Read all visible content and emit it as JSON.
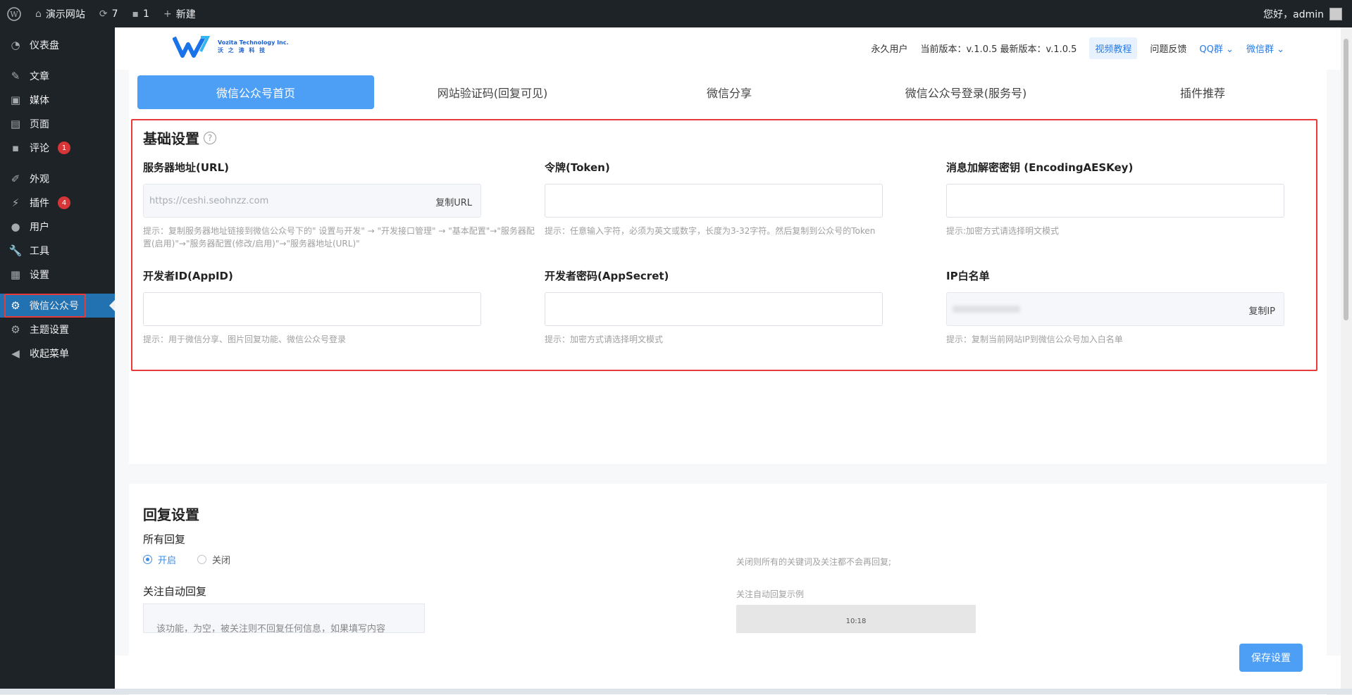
{
  "adminbar": {
    "site_name": "演示网站",
    "updates_count": "7",
    "comments_count": "1",
    "new_label": "新建",
    "greeting": "您好，admin"
  },
  "sidebar": {
    "items": [
      {
        "label": "仪表盘",
        "icon": "dashboard-icon"
      },
      {
        "label": "文章",
        "icon": "pin-icon"
      },
      {
        "label": "媒体",
        "icon": "media-icon"
      },
      {
        "label": "页面",
        "icon": "page-icon"
      },
      {
        "label": "评论",
        "icon": "comment-icon",
        "badge": "1"
      },
      {
        "label": "外观",
        "icon": "brush-icon"
      },
      {
        "label": "插件",
        "icon": "plugin-icon",
        "badge": "4"
      },
      {
        "label": "用户",
        "icon": "user-icon"
      },
      {
        "label": "工具",
        "icon": "wrench-icon"
      },
      {
        "label": "设置",
        "icon": "settings-icon"
      },
      {
        "label": "微信公众号",
        "icon": "gear-icon",
        "current": true
      },
      {
        "label": "主题设置",
        "icon": "gear-icon"
      },
      {
        "label": "收起菜单",
        "icon": "collapse-icon"
      }
    ]
  },
  "topbar": {
    "logo_line1": "Vozita Technology Inc.",
    "logo_line2": "沃 之 涛 科 技",
    "user_type": "永久用户",
    "version": "当前版本：v.1.0.5 最新版本：v.1.0.5",
    "video_tutorial": "视频教程",
    "feedback": "问题反馈",
    "qq_group": "QQ群",
    "wechat_group": "微信群"
  },
  "tabs": [
    "微信公众号首页",
    "网站验证码(回复可见)",
    "微信分享",
    "微信公众号登录(服务号)",
    "插件推荐"
  ],
  "basic": {
    "title": "基础设置",
    "url_label": "服务器地址(URL)",
    "url_value": "https://ceshi.seohnzz.com",
    "url_copy": "复制URL",
    "url_hint": "提示：复制服务器地址链接到微信公众号下的\" 设置与开发\" → \"开发接口管理\" → \"基本配置\"→\"服务器配置(启用)\"→\"服务器配置(修改/启用)\"→\"服务器地址(URL)\"",
    "token_label": "令牌(Token)",
    "token_hint": "提示：任意输入字符，必须为英文或数字，长度为3-32字符。然后复制到公众号的Token",
    "aes_label": "消息加解密密钥 (EncodingAESKey)",
    "aes_hint": "提示:加密方式请选择明文模式",
    "appid_label": "开发者ID(AppID)",
    "appid_hint": "提示：用于微信分享、图片回复功能、微信公众号登录",
    "secret_label": "开发者密码(AppSecret)",
    "secret_hint": "提示：加密方式请选择明文模式",
    "ip_label": "IP白名单",
    "ip_copy": "复制IP",
    "ip_hint": "提示：复制当前网站IP到微信公众号加入白名单"
  },
  "reply": {
    "title": "回复设置",
    "all_reply": "所有回复",
    "on": "开启",
    "off": "关闭",
    "follow_reply": "关注自动回复",
    "off_hint": "关闭则所有的关键词及关注都不会再回复;",
    "example_label": "关注自动回复示例",
    "phone_time": "10:18",
    "textarea_text": "该功能，为空，被关注则不回复任何信息，如果填写内容"
  },
  "save_label": "保存设置"
}
